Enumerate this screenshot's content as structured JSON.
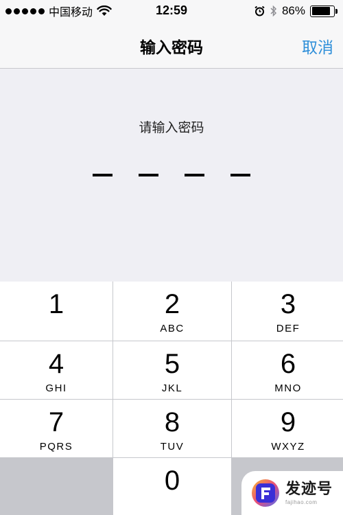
{
  "status_bar": {
    "carrier": "中国移动",
    "time": "12:59",
    "battery_percent": "86%",
    "battery_level": 0.86,
    "signal_bars": 5,
    "icons": [
      "wifi-icon",
      "alarm-icon",
      "bluetooth-icon",
      "battery-icon"
    ]
  },
  "nav": {
    "title": "输入密码",
    "cancel_label": "取消",
    "accent_color": "#2f8fd9"
  },
  "passcode": {
    "prompt": "请输入密码",
    "length": 4,
    "entered": 0
  },
  "keypad": {
    "keys": [
      {
        "digit": "1",
        "letters": ""
      },
      {
        "digit": "2",
        "letters": "ABC"
      },
      {
        "digit": "3",
        "letters": "DEF"
      },
      {
        "digit": "4",
        "letters": "GHI"
      },
      {
        "digit": "5",
        "letters": "JKL"
      },
      {
        "digit": "6",
        "letters": "MNO"
      },
      {
        "digit": "7",
        "letters": "PQRS"
      },
      {
        "digit": "8",
        "letters": "TUV"
      },
      {
        "digit": "9",
        "letters": "WXYZ"
      },
      {
        "digit": "0",
        "letters": ""
      }
    ],
    "delete_icon": "backspace-icon"
  },
  "watermark": {
    "text": "发迹号",
    "subtext": "fajihao.com"
  }
}
